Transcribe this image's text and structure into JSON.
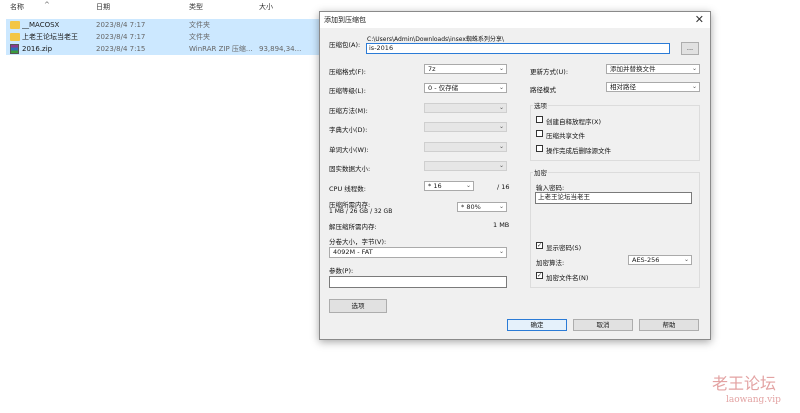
{
  "explorer": {
    "columns": {
      "name": "名称",
      "date": "日期",
      "type": "类型",
      "size": "大小"
    },
    "files": [
      {
        "name": "__MACOSX",
        "date": "2023/8/4 7:17",
        "type": "文件夹",
        "size": "",
        "icon": "folder-icon"
      },
      {
        "name": "上老王论坛当老王",
        "date": "2023/8/4 7:17",
        "type": "文件夹",
        "size": "",
        "icon": "folder-icon"
      },
      {
        "name": "2016.zip",
        "date": "2023/8/4 7:15",
        "type": "WinRAR ZIP 压缩...",
        "size": "93,894,34...",
        "icon": "winrar-zip-icon"
      }
    ]
  },
  "dialog": {
    "title": "添加到压缩包",
    "close": "✕",
    "archive_label": "压缩包(A):",
    "archive_path": "C:\\Users\\Admin\\Downloads\\insex蜘蛛系列分享\\",
    "archive_name": "is-2016",
    "browse": "...",
    "format_label": "压缩格式(F):",
    "format_value": "7z",
    "level_label": "压缩等级(L):",
    "level_value": "0 - 仅存储",
    "method_label": "压缩方法(M):",
    "dict_label": "字典大小(D):",
    "word_label": "单词大小(W):",
    "solid_label": "固实数据大小:",
    "cpu_label": "CPU 线程数:",
    "cpu_value": "* 16",
    "cpu_total": "/ 16",
    "mem_comp_label": "压缩所需内存:",
    "mem_comp_sub": "1 MB / 26 GB / 32 GB",
    "mem_comp_value": "* 80%",
    "mem_decomp_label": "解压缩所需内存:",
    "mem_decomp_value": "1 MB",
    "volume_label": "分卷大小，字节(V):",
    "volume_value": "4092M - FAT",
    "params_label": "参数(P):",
    "options_btn": "选项",
    "update_label": "更新方式(U):",
    "update_value": "添加并替换文件",
    "pathmode_label": "路径模式",
    "pathmode_value": "相对路径",
    "options_group": "选项",
    "opt_sfx": "创建自释放程序(X)",
    "opt_shared": "压缩共享文件",
    "opt_delete": "操作完成后删除源文件",
    "encrypt_group": "加密",
    "password_label": "输入密码:",
    "password_value": "上老王论坛当老王",
    "show_password": "显示密码(S)",
    "enc_method_label": "加密算法:",
    "enc_method_value": "AES-256",
    "encrypt_names": "加密文件名(N)",
    "ok": "确定",
    "cancel": "取消",
    "help": "帮助"
  },
  "watermark": {
    "cn": "老王论坛",
    "en": "laowang.vip"
  }
}
